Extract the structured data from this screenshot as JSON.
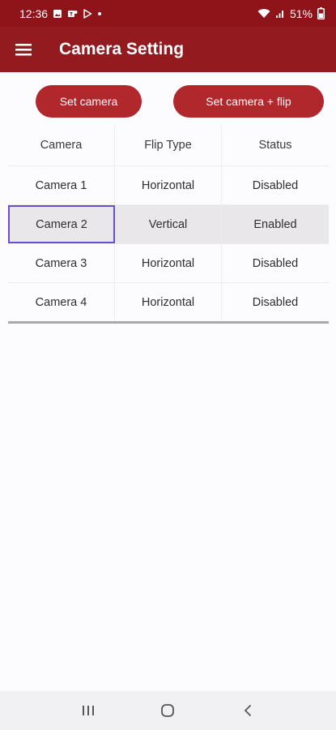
{
  "status_bar": {
    "time": "12:36",
    "battery": "51%"
  },
  "app_bar": {
    "title": "Camera Setting",
    "menu_icon": "hamburger-menu-icon"
  },
  "actions": {
    "set_camera": "Set camera",
    "set_camera_flip": "Set camera + flip"
  },
  "table": {
    "headers": [
      "Camera",
      "Flip Type",
      "Status"
    ],
    "rows": [
      [
        "Camera 1",
        "Horizontal",
        "Disabled"
      ],
      [
        "Camera 2",
        "Vertical",
        "Enabled"
      ],
      [
        "Camera 3",
        "Horizontal",
        "Disabled"
      ],
      [
        "Camera 4",
        "Horizontal",
        "Disabled"
      ]
    ]
  },
  "colors": {
    "status_bar": "#8e1419",
    "app_bar": "#931a1e",
    "button": "#b0272c",
    "selection": "#6a4fcb"
  }
}
